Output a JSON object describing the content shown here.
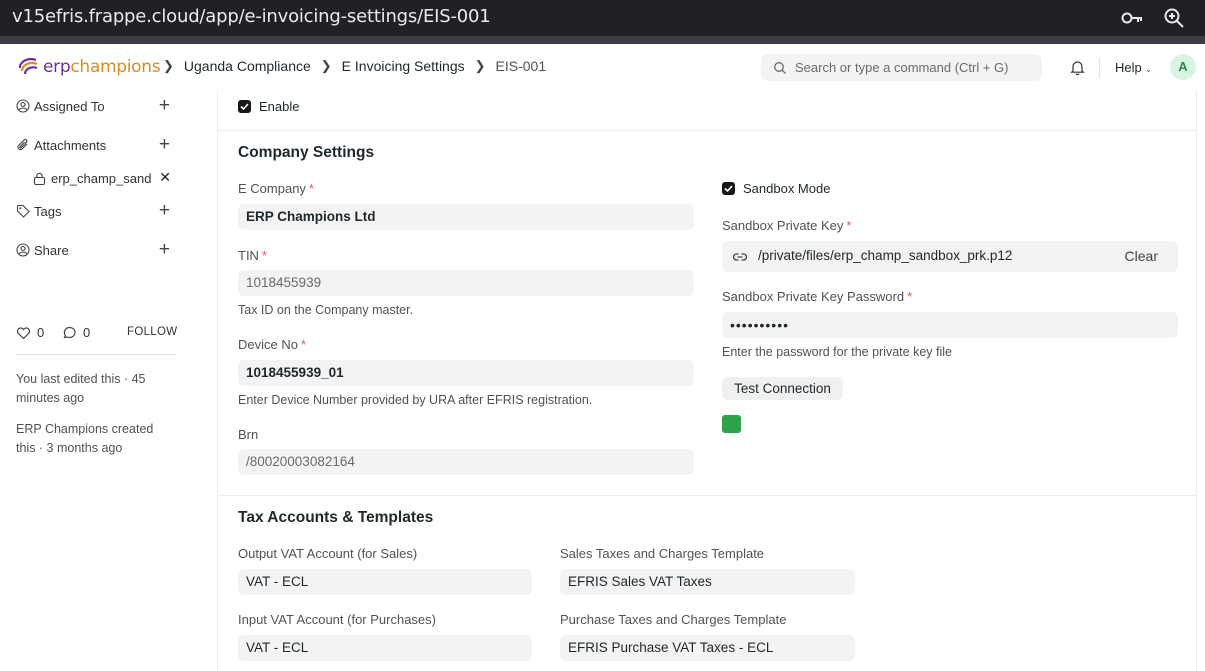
{
  "browser": {
    "url": "v15efris.frappe.cloud/app/e-invoicing-settings/EIS-001"
  },
  "navbar": {
    "logo_erp": "erp",
    "logo_champ": "champions",
    "breadcrumbs": [
      "Uganda Compliance",
      "E Invoicing Settings",
      "EIS-001"
    ],
    "search_placeholder": "Search or type a command (Ctrl + G)",
    "help_label": "Help",
    "avatar_initial": "A"
  },
  "sidebar": {
    "assigned_to": "Assigned To",
    "attachments": "Attachments",
    "attachment_file": "erp_champ_sand",
    "tags": "Tags",
    "share": "Share",
    "likes_count": "0",
    "comments_count": "0",
    "follow_label": "FOLLOW",
    "activity_edit": "You last edited this · 45 minutes ago",
    "activity_created": "ERP Champions created this · 3 months ago"
  },
  "form": {
    "enable_label": "Enable",
    "enable_checked": true,
    "company_settings": {
      "title": "Company Settings",
      "e_company_label": "E Company",
      "e_company_value": "ERP Champions Ltd",
      "tin_label": "TIN",
      "tin_value": "1018455939",
      "tin_desc": "Tax ID on the Company master.",
      "device_no_label": "Device No",
      "device_no_value": "1018455939_01",
      "device_no_desc": "Enter Device Number provided by URA after EFRIS registration.",
      "brn_label": "Brn",
      "brn_value": "/80020003082164",
      "sandbox_mode_label": "Sandbox Mode",
      "sandbox_mode_checked": true,
      "sandbox_key_label": "Sandbox Private Key",
      "sandbox_key_value": "/private/files/erp_champ_sandbox_prk.p12",
      "clear_label": "Clear",
      "sandbox_pwd_label": "Sandbox Private Key Password",
      "sandbox_pwd_value": "••••••••••",
      "sandbox_pwd_desc": "Enter the password for the private key file",
      "test_connection_label": "Test Connection",
      "status_color": "#2aa349"
    },
    "tax_accounts": {
      "title": "Tax Accounts & Templates",
      "output_vat_label": "Output VAT Account (for Sales)",
      "output_vat_value": "VAT - ECL",
      "input_vat_label": "Input VAT Account (for Purchases)",
      "input_vat_value": "VAT - ECL",
      "sales_template_label": "Sales Taxes and Charges Template",
      "sales_template_value": "EFRIS Sales VAT Taxes",
      "purchase_template_label": "Purchase Taxes and Charges Template",
      "purchase_template_value": "EFRIS Purchase VAT Taxes - ECL"
    }
  }
}
